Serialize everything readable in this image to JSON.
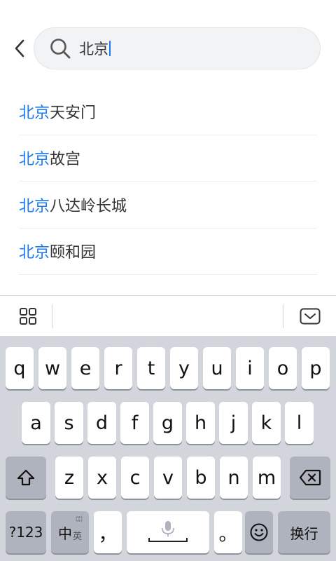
{
  "search": {
    "value": "北京"
  },
  "suggestions": [
    {
      "highlight": "北京",
      "rest": "天安门"
    },
    {
      "highlight": "北京",
      "rest": "故宫"
    },
    {
      "highlight": "北京",
      "rest": "八达岭长城"
    },
    {
      "highlight": "北京",
      "rest": "颐和园"
    }
  ],
  "keyboard": {
    "row1": [
      "q",
      "w",
      "e",
      "r",
      "t",
      "y",
      "u",
      "i",
      "o",
      "p"
    ],
    "row2": [
      "a",
      "s",
      "d",
      "f",
      "g",
      "h",
      "j",
      "k",
      "l"
    ],
    "row3": [
      "z",
      "x",
      "c",
      "v",
      "b",
      "n",
      "m"
    ],
    "num_key": "?123",
    "lang_key_main": "中",
    "lang_key_sub": "英",
    "comma_key": "，",
    "period_key": "。",
    "enter_key": "换行"
  },
  "colors": {
    "accent": "#1a7bf2",
    "keyboard_bg": "#d2d5db",
    "func_key": "#aeb3bd"
  },
  "icons": {
    "back": "chevron-left-icon",
    "search": "magnifier-icon",
    "grid": "grid-icon",
    "hide_keyboard": "keyboard-hide-icon",
    "shift": "shift-icon",
    "delete": "backspace-icon",
    "mic": "microphone-icon",
    "emoji": "emoji-icon",
    "globe": "globe-icon"
  }
}
